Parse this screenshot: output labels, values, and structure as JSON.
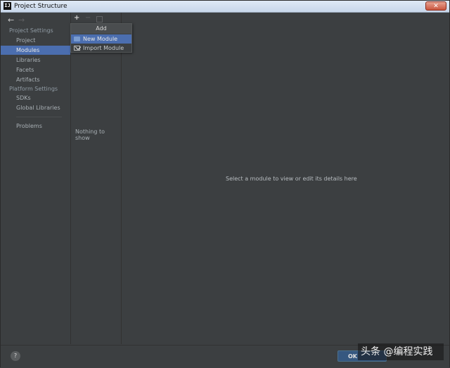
{
  "window": {
    "title": "Project Structure",
    "app_icon_text": "IJ",
    "close_glyph": "✕"
  },
  "nav": {
    "back": "←",
    "forward": "→"
  },
  "sidebar": {
    "project_settings_header": "Project Settings",
    "project_settings": [
      {
        "label": "Project",
        "selected": false
      },
      {
        "label": "Modules",
        "selected": true
      },
      {
        "label": "Libraries",
        "selected": false
      },
      {
        "label": "Facets",
        "selected": false
      },
      {
        "label": "Artifacts",
        "selected": false
      }
    ],
    "platform_settings_header": "Platform Settings",
    "platform_settings": [
      {
        "label": "SDKs"
      },
      {
        "label": "Global Libraries"
      }
    ],
    "problems": "Problems"
  },
  "modules_panel": {
    "add_glyph": "+",
    "remove_glyph": "−",
    "empty_text": "Nothing to show"
  },
  "add_popup": {
    "title": "Add",
    "items": [
      {
        "label": "New Module",
        "icon": "folder-icon",
        "selected": true
      },
      {
        "label": "Import Module",
        "icon": "import-icon",
        "selected": false
      }
    ]
  },
  "details": {
    "placeholder": "Select a module to view or edit its details here"
  },
  "footer": {
    "help_glyph": "?",
    "ok_label": "OK"
  },
  "watermark": {
    "text": "头条 @编程实践"
  },
  "colors": {
    "background": "#3c3f41",
    "selection": "#4b6eaf",
    "ok_button": "#365880"
  }
}
